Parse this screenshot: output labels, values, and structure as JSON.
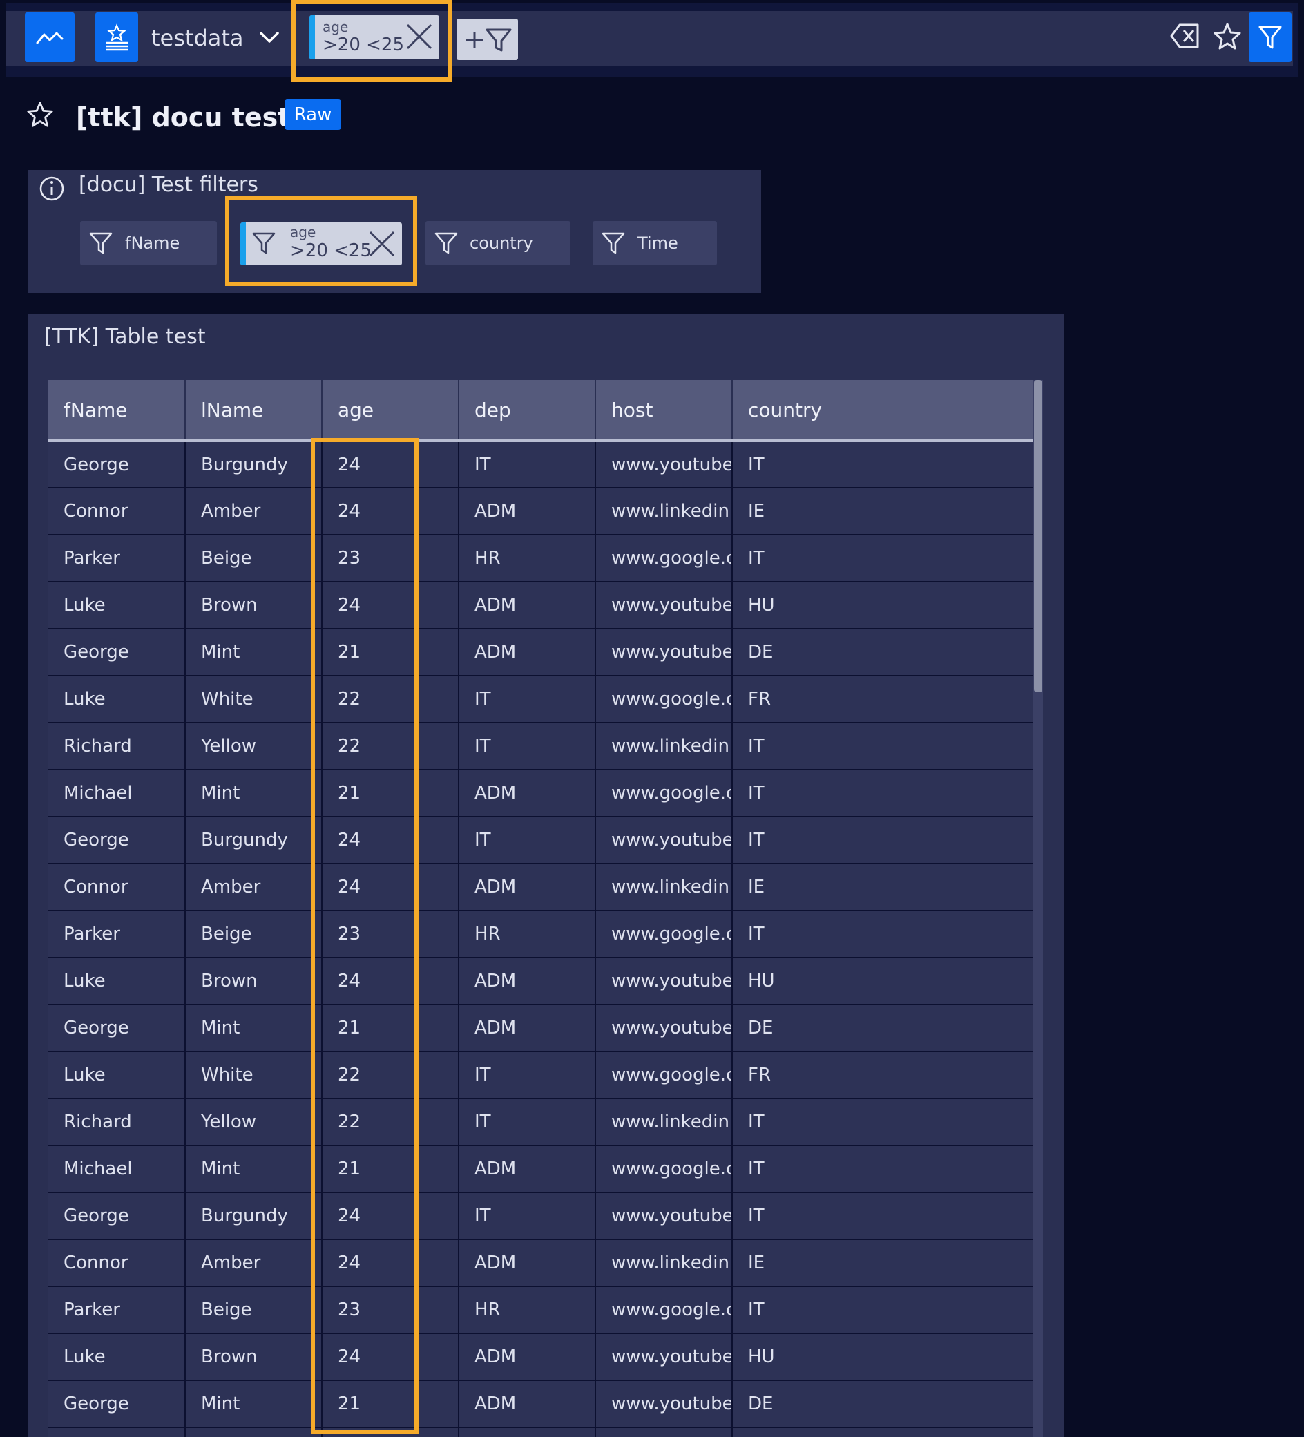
{
  "header": {
    "dataset_name": "testdata",
    "active_filter": {
      "field": "age",
      "value": ">20 <25"
    },
    "icons": {
      "app": "activity-icon",
      "dataset": "dataset-icon",
      "chevron": "chevron-down-icon",
      "add_filter": "add-filter-icon",
      "clear": "clear-filters-icon",
      "favorite": "star-icon",
      "filters": "filter-icon"
    }
  },
  "page": {
    "title": "[ttk] docu test",
    "badge": "Raw"
  },
  "filters_panel": {
    "title": "[docu] Test filters",
    "filters": [
      {
        "label": "fName"
      },
      {
        "field": "age",
        "value": ">20 <25"
      },
      {
        "label": "country"
      },
      {
        "label": "Time"
      }
    ]
  },
  "table_panel": {
    "title": "[TTK] Table test",
    "columns": [
      "fName",
      "lName",
      "age",
      "dep",
      "host",
      "country"
    ],
    "rows": [
      [
        "George",
        "Burgundy",
        "24",
        "IT",
        "www.youtube",
        "IT"
      ],
      [
        "Connor",
        "Amber",
        "24",
        "ADM",
        "www.linkedin.",
        "IE"
      ],
      [
        "Parker",
        "Beige",
        "23",
        "HR",
        "www.google.c",
        "IT"
      ],
      [
        "Luke",
        "Brown",
        "24",
        "ADM",
        "www.youtube",
        "HU"
      ],
      [
        "George",
        "Mint",
        "21",
        "ADM",
        "www.youtube",
        "DE"
      ],
      [
        "Luke",
        "White",
        "22",
        "IT",
        "www.google.c",
        "FR"
      ],
      [
        "Richard",
        "Yellow",
        "22",
        "IT",
        "www.linkedin.",
        "IT"
      ],
      [
        "Michael",
        "Mint",
        "21",
        "ADM",
        "www.google.c",
        "IT"
      ],
      [
        "George",
        "Burgundy",
        "24",
        "IT",
        "www.youtube",
        "IT"
      ],
      [
        "Connor",
        "Amber",
        "24",
        "ADM",
        "www.linkedin.",
        "IE"
      ],
      [
        "Parker",
        "Beige",
        "23",
        "HR",
        "www.google.c",
        "IT"
      ],
      [
        "Luke",
        "Brown",
        "24",
        "ADM",
        "www.youtube",
        "HU"
      ],
      [
        "George",
        "Mint",
        "21",
        "ADM",
        "www.youtube",
        "DE"
      ],
      [
        "Luke",
        "White",
        "22",
        "IT",
        "www.google.c",
        "FR"
      ],
      [
        "Richard",
        "Yellow",
        "22",
        "IT",
        "www.linkedin.",
        "IT"
      ],
      [
        "Michael",
        "Mint",
        "21",
        "ADM",
        "www.google.c",
        "IT"
      ],
      [
        "George",
        "Burgundy",
        "24",
        "IT",
        "www.youtube",
        "IT"
      ],
      [
        "Connor",
        "Amber",
        "24",
        "ADM",
        "www.linkedin.",
        "IE"
      ],
      [
        "Parker",
        "Beige",
        "23",
        "HR",
        "www.google.c",
        "IT"
      ],
      [
        "Luke",
        "Brown",
        "24",
        "ADM",
        "www.youtube",
        "HU"
      ],
      [
        "George",
        "Mint",
        "21",
        "ADM",
        "www.youtube",
        "DE"
      ],
      [
        "",
        "",
        "",
        "",
        "",
        ""
      ]
    ]
  },
  "colors": {
    "background": "#080c24",
    "panel": "#2a2f52",
    "accent_blue": "#0a6cf0",
    "highlight": "#f6ab2a",
    "chip": "#cfd3e1"
  }
}
